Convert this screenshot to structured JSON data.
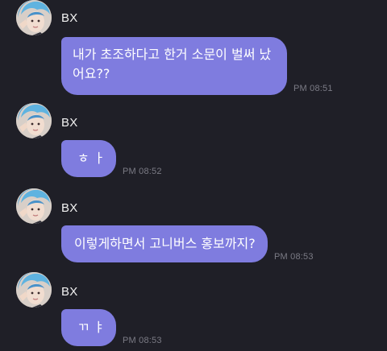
{
  "chat": {
    "messages": [
      {
        "sender": "BX",
        "text": "내가 초조하다고 한거 소문이 벌써 났\n어요??",
        "time": "PM 08:51"
      },
      {
        "sender": "BX",
        "text": "ㅎ ㅏ",
        "time": "PM 08:52"
      },
      {
        "sender": "BX",
        "text": "이렇게하면서 고니버스 홍보까지?",
        "time": "PM 08:53"
      },
      {
        "sender": "BX",
        "text": "ㄲ ㅑ",
        "time": "PM 08:53"
      }
    ]
  },
  "colors": {
    "background": "#1f1f27",
    "bubble": "#7f7cdf",
    "sender_text": "#f2f2f2",
    "timestamp": "#7b7b85"
  },
  "icons": {
    "avatar": "profile-photo-avatar"
  }
}
